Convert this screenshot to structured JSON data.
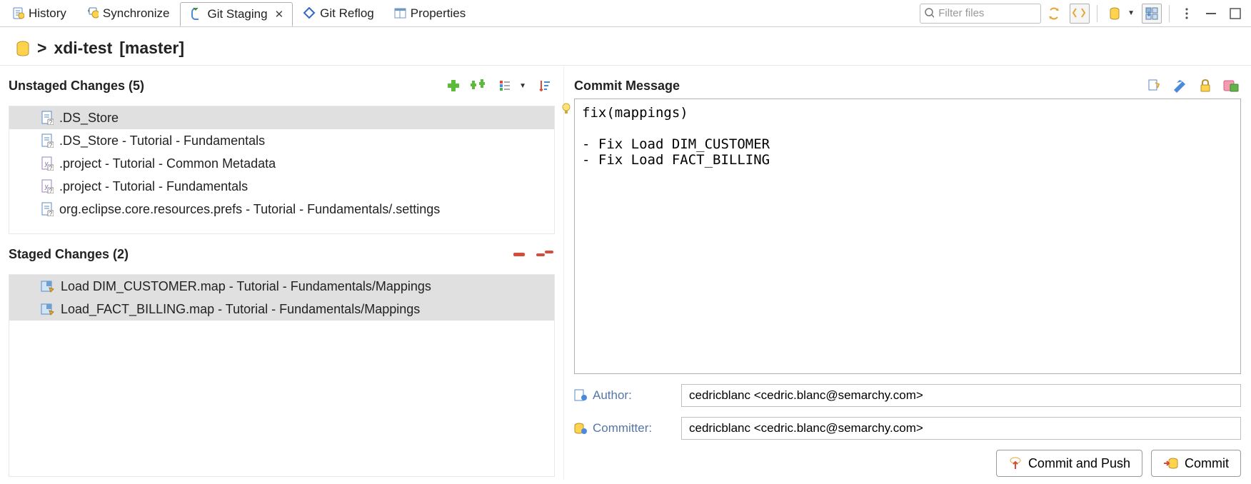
{
  "tabs": {
    "history": "History",
    "synchronize": "Synchronize",
    "git_staging": "Git Staging",
    "git_reflog": "Git Reflog",
    "properties": "Properties"
  },
  "search": {
    "placeholder": "Filter files"
  },
  "repo": {
    "prefix": ">",
    "name": "xdi-test",
    "branch": "[master]"
  },
  "unstaged": {
    "title": "Unstaged Changes (5)",
    "items": [
      {
        "label": ".DS_Store",
        "icon": "file-unknown"
      },
      {
        "label": ".DS_Store - Tutorial - Fundamentals",
        "icon": "file-unknown"
      },
      {
        "label": ".project - Tutorial - Common Metadata",
        "icon": "file-xml"
      },
      {
        "label": ".project - Tutorial - Fundamentals",
        "icon": "file-xml"
      },
      {
        "label": "org.eclipse.core.resources.prefs - Tutorial - Fundamentals/.settings",
        "icon": "file-unknown"
      }
    ]
  },
  "staged": {
    "title": "Staged Changes (2)",
    "items": [
      {
        "label": "Load DIM_CUSTOMER.map - Tutorial - Fundamentals/Mappings",
        "icon": "map"
      },
      {
        "label": "Load_FACT_BILLING.map - Tutorial - Fundamentals/Mappings",
        "icon": "map"
      }
    ]
  },
  "commit": {
    "title": "Commit Message",
    "text": "fix(mappings)\n\n- Fix Load DIM_CUSTOMER\n- Fix Load FACT_BILLING",
    "author_label": "Author:",
    "author_value": "cedricblanc <cedric.blanc@semarchy.com>",
    "committer_label": "Committer:",
    "committer_value": "cedricblanc <cedric.blanc@semarchy.com>",
    "commit_push_btn": "Commit and Push",
    "commit_btn": "Commit"
  }
}
